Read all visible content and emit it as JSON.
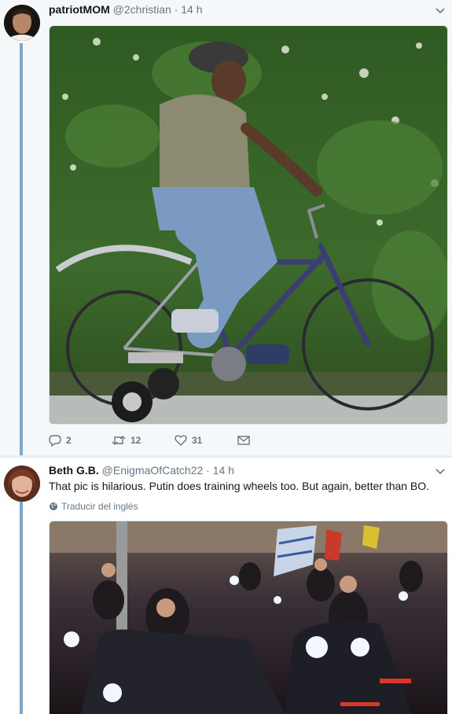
{
  "tweet1": {
    "name": "patriotMOM",
    "handle": "@2christian",
    "separator": "·",
    "time": "14 h",
    "replies": "2",
    "retweets": "12",
    "likes": "31",
    "image_alt": "man riding a bicycle with training wheels"
  },
  "tweet2": {
    "name": "Beth G.B.",
    "handle": "@EnigmaOfCatch22",
    "separator": "·",
    "time": "14 h",
    "text": "That pic is hilarious. Putin does training wheels too. But again, better than BO.",
    "translate_label": "Traducir del inglés",
    "image_alt": "motorcycle riders with a trike in a parade at night"
  },
  "icons": {
    "reply": "reply-icon",
    "retweet": "retweet-icon",
    "like": "heart-icon",
    "dm": "envelope-icon",
    "caret": "chevron-down-icon",
    "globe": "globe-icon"
  },
  "colors": {
    "thread_line": "#7fa8c8",
    "secondary_text": "#657786",
    "background": "#f5f8fa"
  }
}
